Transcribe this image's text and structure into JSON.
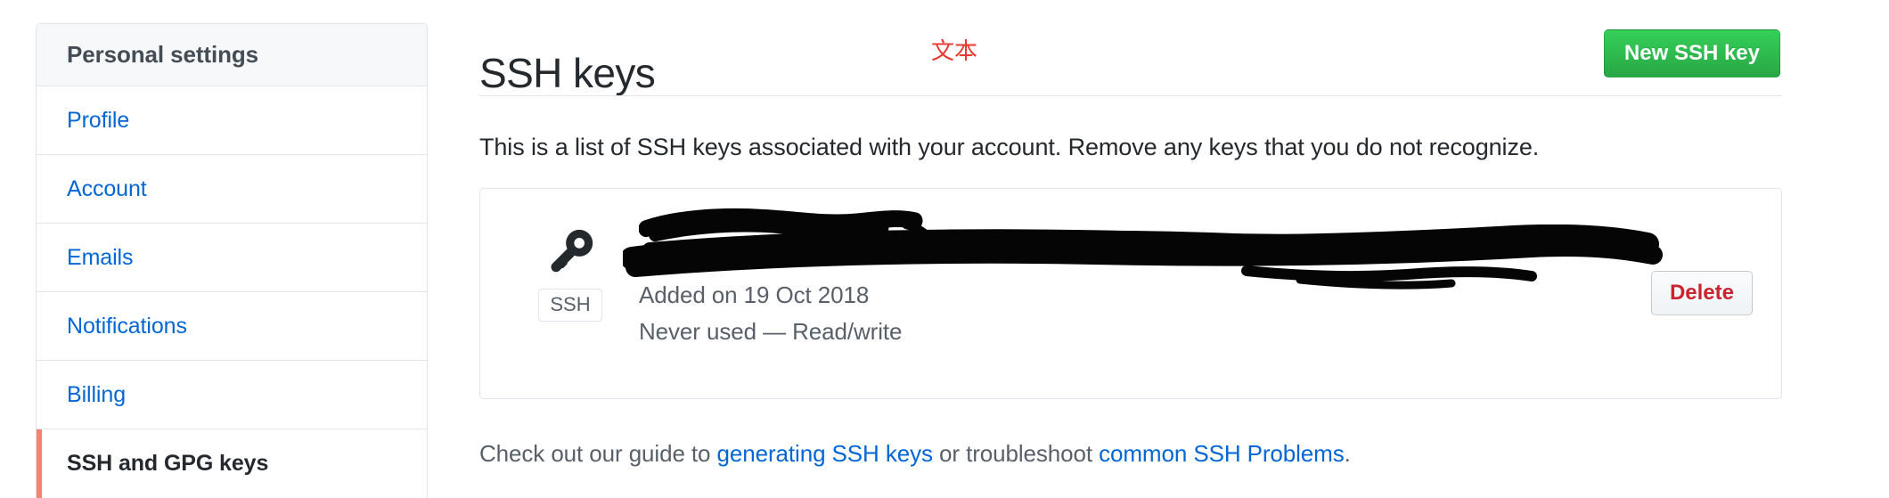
{
  "sidebar": {
    "header_label": "Personal settings",
    "items": [
      {
        "label": "Profile",
        "active": false
      },
      {
        "label": "Account",
        "active": false
      },
      {
        "label": "Emails",
        "active": false
      },
      {
        "label": "Notifications",
        "active": false
      },
      {
        "label": "Billing",
        "active": false
      },
      {
        "label": "SSH and GPG keys",
        "active": true
      }
    ],
    "active_border_color": "#f9826c"
  },
  "main": {
    "title": "SSH keys",
    "new_key_button": "New SSH key",
    "new_key_button_color": "#28a745",
    "description": "This is a list of SSH keys associated with your account. Remove any keys that you do not recognize."
  },
  "key_card": {
    "icon_name": "key-icon",
    "badge": "SSH",
    "title_redacted": true,
    "added_on": "Added on 19 Oct 2018",
    "usage": "Never used — Read/write",
    "delete_button": "Delete",
    "delete_button_color": "#cb2431"
  },
  "annotation": {
    "text": "文本",
    "color": "#e8392f"
  },
  "footer": {
    "prefix": "Check out our guide to ",
    "link1": "generating SSH keys",
    "middle": " or troubleshoot ",
    "link2": "common SSH Problems",
    "suffix": "."
  }
}
